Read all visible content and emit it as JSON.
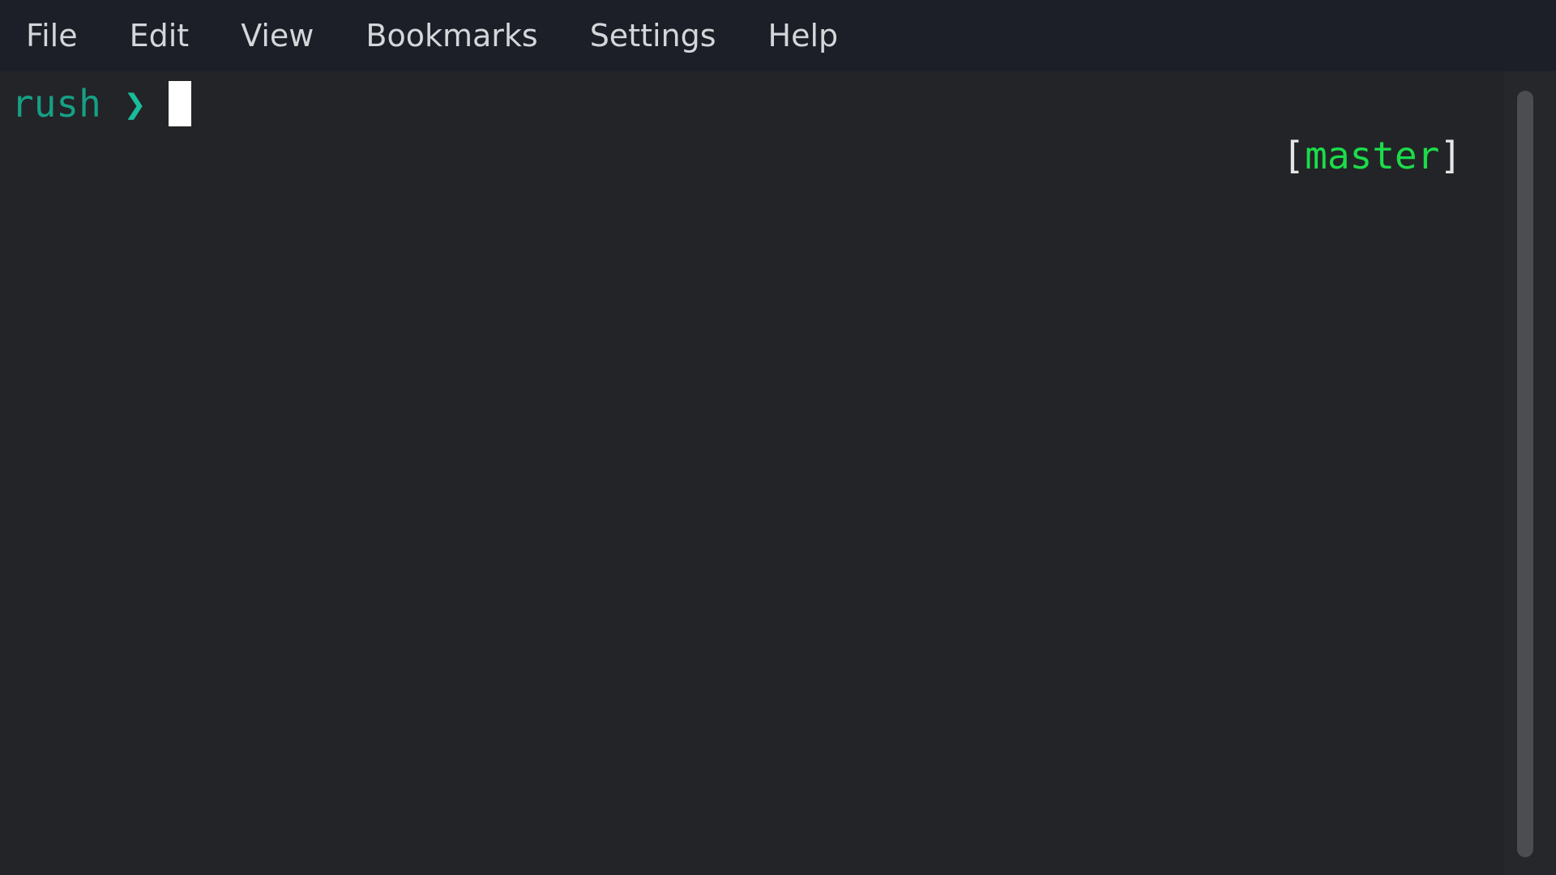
{
  "menubar": {
    "items": [
      {
        "label": "File"
      },
      {
        "label": "Edit"
      },
      {
        "label": "View"
      },
      {
        "label": "Bookmarks"
      },
      {
        "label": "Settings"
      },
      {
        "label": "Help"
      }
    ]
  },
  "terminal": {
    "prompt_name": "rush",
    "prompt_arrow": "❯",
    "git_open": "[",
    "git_branch": "master",
    "git_close": "]"
  },
  "colors": {
    "prompt": "#16a085",
    "branch": "#1cdc4a",
    "background": "#232427",
    "menubar": "#1c1f27"
  }
}
